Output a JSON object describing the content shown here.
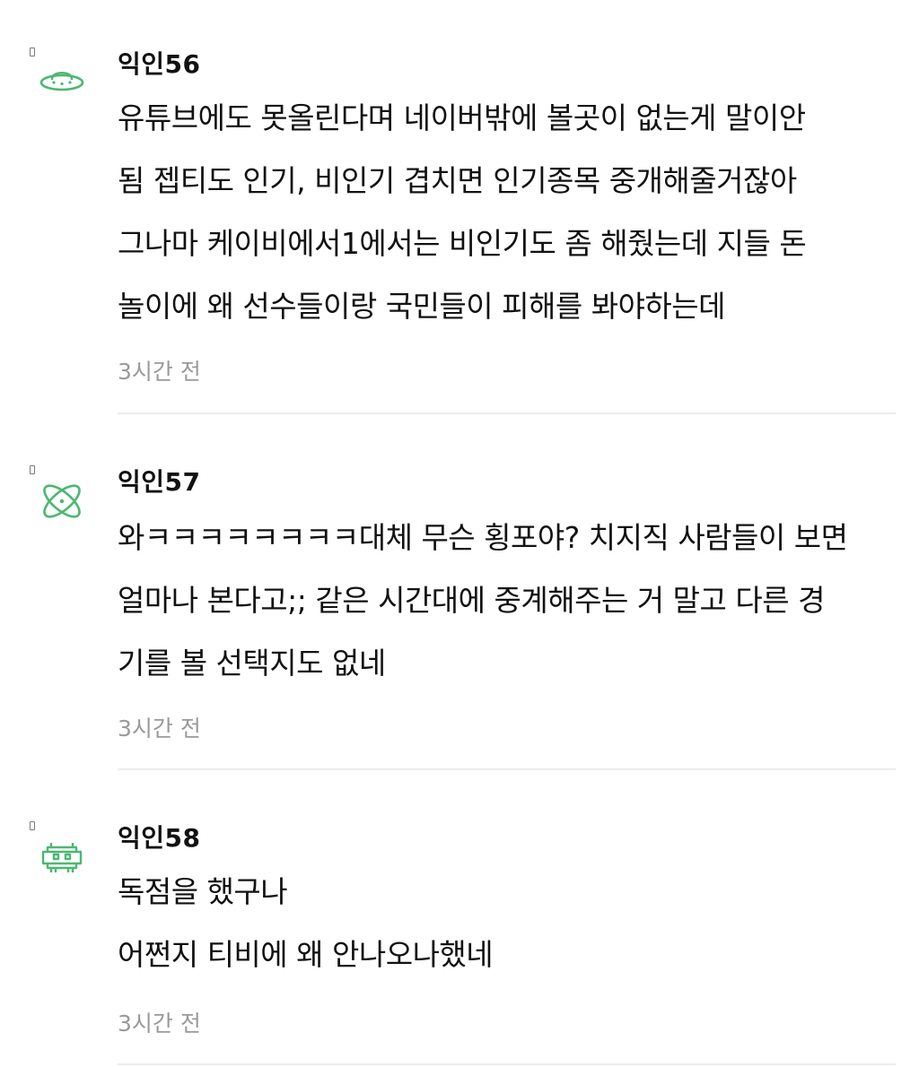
{
  "comments": [
    {
      "author": "익인56",
      "avatar_icon": "ufo-icon",
      "lines": [
        "유튜브에도 못올린다며 네이버밖에 볼곳이 없는게 말이안",
        "됨 젭티도 인기, 비인기 겹치면 인기종목 중개해줄거잖아",
        "그나마 케이비에서1에서는 비인기도 좀 해줬는데 지들 돈",
        "놀이에 왜 선수들이랑 국민들이 피해를 봐야하는데"
      ],
      "time": "3시간 전"
    },
    {
      "author": "익인57",
      "avatar_icon": "atom-icon",
      "lines": [
        "와ㅋㅋㅋㅋㅋㅋㅋㅋ대체 무슨 횡포야? 치지직 사람들이 보면",
        "얼마나 본다고;; 같은 시간대에 중계해주는 거 말고 다른 경",
        "기를 볼 선택지도 없네"
      ],
      "time": "3시간 전"
    },
    {
      "author": "익인58",
      "avatar_icon": "space-invader-icon",
      "lines": [
        "독점을 했구나",
        "어쩐지 티비에 왜 안나오나했네"
      ],
      "time": "3시간 전"
    }
  ],
  "colors": {
    "avatar_green": "#4bb872",
    "text": "#111111",
    "muted": "#9a9a9a",
    "divider": "#ececec"
  }
}
